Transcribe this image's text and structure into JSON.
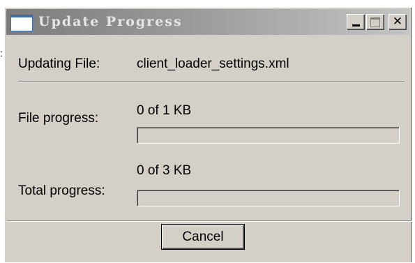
{
  "window": {
    "title": "Update Progress",
    "icon": "window-app-icon",
    "controls": [
      "minimize-icon",
      "maximize-icon",
      "close-icon"
    ],
    "title_colors": {
      "start": "#7c7c7c",
      "end": "#c4c4c4"
    }
  },
  "side_mark": ":",
  "updating": {
    "label": "Updating File:",
    "file_name": "client_loader_settings.xml"
  },
  "file_progress": {
    "label": "File progress:",
    "status": "0 of 1 KB",
    "fraction": 0
  },
  "total_progress": {
    "label": "Total progress:",
    "status": "0 of 3 KB",
    "fraction": 0
  },
  "footer": {
    "cancel_label": "Cancel"
  }
}
